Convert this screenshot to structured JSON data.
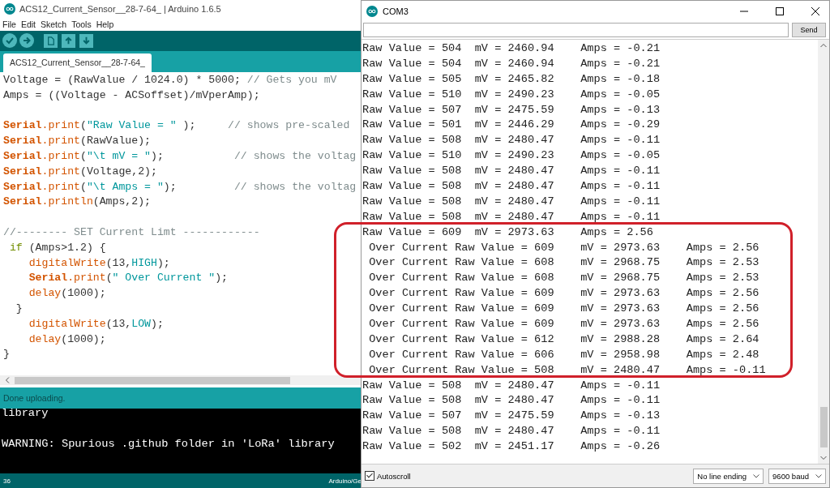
{
  "ide": {
    "title": "ACS12_Current_Sensor__28-7-64_ | Arduino 1.6.5",
    "menu": [
      "File",
      "Edit",
      "Sketch",
      "Tools",
      "Help"
    ],
    "tabs": [
      {
        "label": "ACS12_Current_Sensor__28-7-64_",
        "selected": true
      }
    ],
    "code_lines": [
      {
        "kind": "code",
        "tokens": [
          {
            "kind": "plain",
            "text": "Voltage = (RawValue / 1024.0) * 5000; "
          },
          {
            "kind": "comment",
            "text": "// Gets you mV"
          }
        ]
      },
      {
        "kind": "code",
        "tokens": [
          {
            "kind": "plain",
            "text": "Amps = ((Voltage - ACSoffset)/mVperAmp);"
          }
        ]
      },
      {
        "kind": "blank"
      },
      {
        "kind": "code",
        "tokens": [
          {
            "kind": "keyword",
            "text": "Serial"
          },
          {
            "kind": "function",
            "text": ".print"
          },
          {
            "kind": "plain",
            "text": "("
          },
          {
            "kind": "string",
            "text": "\"Raw Value = \""
          },
          {
            "kind": "plain",
            "text": " );     "
          },
          {
            "kind": "comment",
            "text": "// shows pre-scaled"
          }
        ]
      },
      {
        "kind": "code",
        "tokens": [
          {
            "kind": "keyword",
            "text": "Serial"
          },
          {
            "kind": "function",
            "text": ".print"
          },
          {
            "kind": "plain",
            "text": "(RawValue);"
          }
        ]
      },
      {
        "kind": "code",
        "tokens": [
          {
            "kind": "keyword",
            "text": "Serial"
          },
          {
            "kind": "function",
            "text": ".print"
          },
          {
            "kind": "plain",
            "text": "("
          },
          {
            "kind": "string",
            "text": "\"\\t mV = \""
          },
          {
            "kind": "plain",
            "text": ");           "
          },
          {
            "kind": "comment",
            "text": "// shows the voltag"
          }
        ]
      },
      {
        "kind": "code",
        "tokens": [
          {
            "kind": "keyword",
            "text": "Serial"
          },
          {
            "kind": "function",
            "text": ".print"
          },
          {
            "kind": "plain",
            "text": "(Voltage,2);"
          }
        ]
      },
      {
        "kind": "code",
        "tokens": [
          {
            "kind": "keyword",
            "text": "Serial"
          },
          {
            "kind": "function",
            "text": ".print"
          },
          {
            "kind": "plain",
            "text": "("
          },
          {
            "kind": "string",
            "text": "\"\\t Amps = \""
          },
          {
            "kind": "plain",
            "text": ");         "
          },
          {
            "kind": "comment",
            "text": "// shows the voltag"
          }
        ]
      },
      {
        "kind": "code",
        "tokens": [
          {
            "kind": "keyword",
            "text": "Serial"
          },
          {
            "kind": "function",
            "text": ".println"
          },
          {
            "kind": "plain",
            "text": "(Amps,2);"
          }
        ]
      },
      {
        "kind": "blank"
      },
      {
        "kind": "code",
        "tokens": [
          {
            "kind": "comment",
            "text": "//-------- SET Current Limt ------------"
          }
        ]
      },
      {
        "kind": "code",
        "tokens": [
          {
            "kind": "control",
            "text": " if"
          },
          {
            "kind": "plain",
            "text": " (Amps>1.2) {"
          }
        ]
      },
      {
        "kind": "code",
        "tokens": [
          {
            "kind": "function",
            "text": "    digitalWrite"
          },
          {
            "kind": "plain",
            "text": "(13,"
          },
          {
            "kind": "constant",
            "text": "HIGH"
          },
          {
            "kind": "plain",
            "text": ");"
          }
        ]
      },
      {
        "kind": "code",
        "tokens": [
          {
            "kind": "keyword",
            "text": "    Serial"
          },
          {
            "kind": "function",
            "text": ".print"
          },
          {
            "kind": "plain",
            "text": "("
          },
          {
            "kind": "string",
            "text": "\" Over Current \""
          },
          {
            "kind": "plain",
            "text": ");"
          }
        ]
      },
      {
        "kind": "code",
        "tokens": [
          {
            "kind": "function",
            "text": "    delay"
          },
          {
            "kind": "plain",
            "text": "(1000);"
          }
        ]
      },
      {
        "kind": "code",
        "tokens": [
          {
            "kind": "plain",
            "text": "  }"
          }
        ]
      },
      {
        "kind": "code",
        "tokens": [
          {
            "kind": "function",
            "text": "    digitalWrite"
          },
          {
            "kind": "plain",
            "text": "(13,"
          },
          {
            "kind": "constant",
            "text": "LOW"
          },
          {
            "kind": "plain",
            "text": ");"
          }
        ]
      },
      {
        "kind": "code",
        "tokens": [
          {
            "kind": "function",
            "text": "    delay"
          },
          {
            "kind": "plain",
            "text": "(1000);"
          }
        ]
      },
      {
        "kind": "code",
        "tokens": [
          {
            "kind": "plain",
            "text": "}"
          }
        ]
      }
    ],
    "status": "Done uploading.",
    "console_lines": [
      {
        "kind": "text",
        "text": "library"
      },
      {
        "kind": "blank"
      },
      {
        "kind": "text",
        "text": "WARNING: Spurious .github folder in 'LoRa' library"
      }
    ],
    "line_number": "36",
    "board": "Arduino/Ge"
  },
  "monitor": {
    "title": "COM3",
    "send_label": "Send",
    "lines": [
      "Raw Value = 504  mV = 2460.94    Amps = -0.21",
      "Raw Value = 504  mV = 2460.94    Amps = -0.21",
      "Raw Value = 505  mV = 2465.82    Amps = -0.18",
      "Raw Value = 510  mV = 2490.23    Amps = -0.05",
      "Raw Value = 507  mV = 2475.59    Amps = -0.13",
      "Raw Value = 501  mV = 2446.29    Amps = -0.29",
      "Raw Value = 508  mV = 2480.47    Amps = -0.11",
      "Raw Value = 510  mV = 2490.23    Amps = -0.05",
      "Raw Value = 508  mV = 2480.47    Amps = -0.11",
      "Raw Value = 508  mV = 2480.47    Amps = -0.11",
      "Raw Value = 508  mV = 2480.47    Amps = -0.11",
      "Raw Value = 508  mV = 2480.47    Amps = -0.11",
      "Raw Value = 609  mV = 2973.63    Amps = 2.56",
      " Over Current Raw Value = 609    mV = 2973.63    Amps = 2.56",
      " Over Current Raw Value = 608    mV = 2968.75    Amps = 2.53",
      " Over Current Raw Value = 608    mV = 2968.75    Amps = 2.53",
      " Over Current Raw Value = 609    mV = 2973.63    Amps = 2.56",
      " Over Current Raw Value = 609    mV = 2973.63    Amps = 2.56",
      " Over Current Raw Value = 609    mV = 2973.63    Amps = 2.56",
      " Over Current Raw Value = 612    mV = 2988.28    Amps = 2.64",
      " Over Current Raw Value = 606    mV = 2958.98    Amps = 2.48",
      " Over Current Raw Value = 508    mV = 2480.47    Amps = -0.11",
      "Raw Value = 508  mV = 2480.47    Amps = -0.11",
      "Raw Value = 508  mV = 2480.47    Amps = -0.11",
      "Raw Value = 507  mV = 2475.59    Amps = -0.13",
      "Raw Value = 508  mV = 2480.47    Amps = -0.11",
      "Raw Value = 502  mV = 2451.17    Amps = -0.26"
    ],
    "autoscroll": {
      "label": "Autoscroll",
      "checked": true
    },
    "line_ending": "No line ending",
    "baud": "9600 baud"
  }
}
